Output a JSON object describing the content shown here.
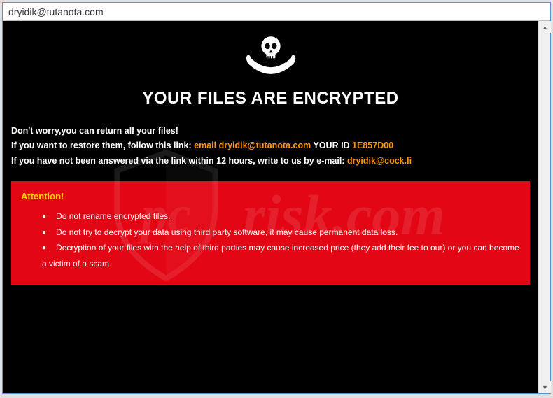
{
  "window": {
    "title": "dryidik@tutanota.com"
  },
  "content": {
    "heading": "YOUR FILES ARE ENCRYPTED",
    "line1": "Don't worry,you can return all your files!",
    "line2_prefix": "If you want to restore them, follow this link: ",
    "line2_email_label": "email dryidik@tutanota.com",
    "line2_yourid": "  YOUR ID ",
    "line2_id": "1E857D00",
    "line3_prefix": "If you have not been answered via the link within 12 hours, write to us by e-mail: ",
    "line3_email": "dryidik@cock.li"
  },
  "attention": {
    "title": "Attention!",
    "items": [
      "Do not rename encrypted files.",
      "Do not try to decrypt your data using third party software, it may cause permanent data loss.",
      "Decryption of your files with the help of third parties may cause increased price (they add their fee to our) or you can become a victim of a scam."
    ]
  },
  "watermark": {
    "text": "risk.com"
  }
}
